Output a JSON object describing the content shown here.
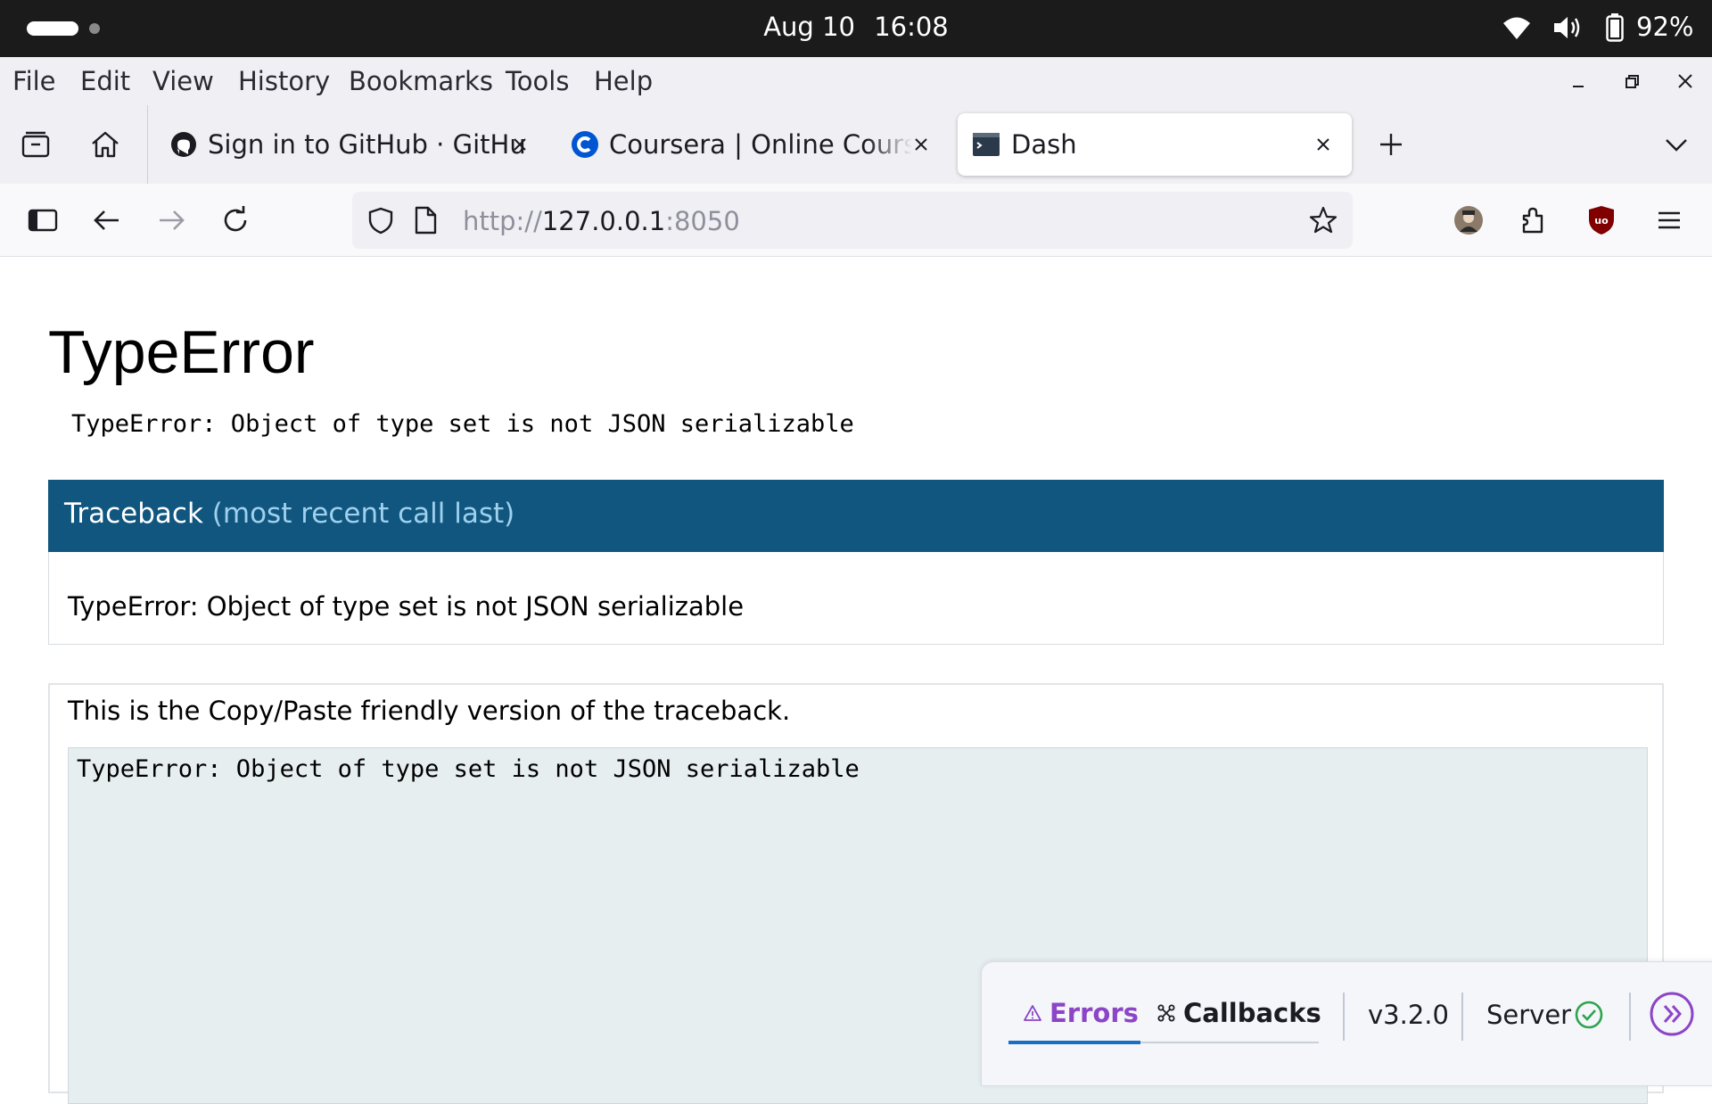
{
  "os": {
    "date": "Aug 10",
    "time": "16:08",
    "battery": "92%"
  },
  "menu": {
    "items": [
      {
        "label": "File"
      },
      {
        "label": "Edit"
      },
      {
        "label": "View"
      },
      {
        "label": "History"
      },
      {
        "label": "Bookmarks"
      },
      {
        "label": "Tools"
      },
      {
        "label": "Help"
      }
    ]
  },
  "tabs": [
    {
      "title": "Sign in to GitHub · GitHub",
      "icon": "github-icon",
      "active": false
    },
    {
      "title": "Coursera | Online Courses",
      "icon": "coursera-icon",
      "active": false
    },
    {
      "title": "Dash",
      "icon": "terminal-icon",
      "active": true
    }
  ],
  "nav": {
    "url_scheme": "http://",
    "url_host": "127.0.0.1",
    "url_port": ":8050"
  },
  "page": {
    "title": "TypeError",
    "subtitle": "TypeError: Object of type set is not JSON serializable",
    "traceback_label": "Traceback",
    "traceback_note": "(most recent call last)",
    "traceback_message": "TypeError: Object of type set is not JSON serializable",
    "copy_paste_label": "This is the Copy/Paste friendly version of the traceback.",
    "copy_paste_text": "TypeError: Object of type set is not JSON serializable"
  },
  "devtools": {
    "errors_label": "Errors",
    "callbacks_label": "Callbacks",
    "version": "v3.2.0",
    "server_label": "Server",
    "accent_color": "#8c45c7",
    "status_color": "#2ea44f"
  }
}
